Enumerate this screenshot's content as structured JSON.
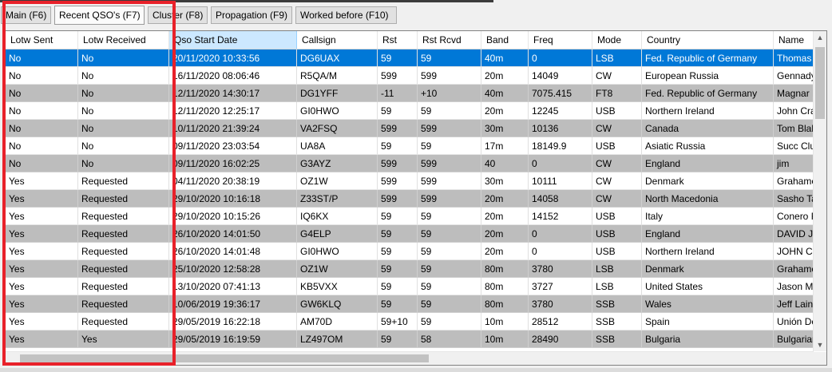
{
  "tabs": [
    {
      "label": "Main (F6)",
      "active": false
    },
    {
      "label": "Recent QSO's (F7)",
      "active": true
    },
    {
      "label": "Cluster (F8)",
      "active": false
    },
    {
      "label": "Propagation (F9)",
      "active": false
    },
    {
      "label": "Worked before (F10)",
      "active": false
    }
  ],
  "grid": {
    "columns": [
      "Lotw Sent",
      "Lotw Received",
      "Qso Start Date",
      "Callsign",
      "Rst",
      "Rst Rcvd",
      "Band",
      "Freq",
      "Mode",
      "Country",
      "Name"
    ],
    "sorted_column": "Qso Start Date",
    "rows": [
      [
        "No",
        "No",
        "20/11/2020 10:33:56",
        "DG6UAX",
        "59",
        "59",
        "40m",
        "0",
        "LSB",
        "Fed. Republic of Germany",
        "Thomas"
      ],
      [
        "No",
        "No",
        "16/11/2020 08:06:46",
        "R5QA/M",
        "599",
        "599",
        "20m",
        "14049",
        "CW",
        "European Russia",
        "Gennady"
      ],
      [
        "No",
        "No",
        "12/11/2020 14:30:17",
        "DG1YFF",
        "-11",
        "+10",
        "40m",
        "7075.415",
        "FT8",
        "Fed. Republic of Germany",
        "Magnar F"
      ],
      [
        "No",
        "No",
        "12/11/2020 12:25:17",
        "GI0HWO",
        "59",
        "59",
        "20m",
        "12245",
        "USB",
        "Northern Ireland",
        "John Cra"
      ],
      [
        "No",
        "No",
        "10/11/2020 21:39:24",
        "VA2FSQ",
        "599",
        "599",
        "30m",
        "10136",
        "CW",
        "Canada",
        "Tom Blak"
      ],
      [
        "No",
        "No",
        "09/11/2020 23:03:54",
        "UA8A",
        "59",
        "59",
        "17m",
        "18149.9",
        "USB",
        "Asiatic Russia",
        "Succ Clu"
      ],
      [
        "No",
        "No",
        "09/11/2020 16:02:25",
        "G3AYZ",
        "599",
        "599",
        "40",
        "0",
        "CW",
        "England",
        "jim"
      ],
      [
        "Yes",
        "Requested",
        "04/11/2020 20:38:19",
        "OZ1W",
        "599",
        "599",
        "30m",
        "10111",
        "CW",
        "Denmark",
        "Grahame"
      ],
      [
        "Yes",
        "Requested",
        "29/10/2020 10:16:18",
        "Z33ST/P",
        "599",
        "599",
        "20m",
        "14058",
        "CW",
        "North Macedonia",
        "Sasho Ta"
      ],
      [
        "Yes",
        "Requested",
        "29/10/2020 10:15:26",
        "IQ6KX",
        "59",
        "59",
        "20m",
        "14152",
        "USB",
        "Italy",
        "Conero F"
      ],
      [
        "Yes",
        "Requested",
        "26/10/2020 14:01:50",
        "G4ELP",
        "59",
        "59",
        "20m",
        "0",
        "USB",
        "England",
        "DAVID J"
      ],
      [
        "Yes",
        "Requested",
        "26/10/2020 14:01:48",
        "GI0HWO",
        "59",
        "59",
        "20m",
        "0",
        "USB",
        "Northern Ireland",
        "JOHN CR"
      ],
      [
        "Yes",
        "Requested",
        "25/10/2020 12:58:28",
        "OZ1W",
        "59",
        "59",
        "80m",
        "3780",
        "LSB",
        "Denmark",
        "Grahame"
      ],
      [
        "Yes",
        "Requested",
        "13/10/2020 07:41:13",
        "KB5VXX",
        "59",
        "59",
        "80m",
        "3727",
        "LSB",
        "United States",
        "Jason M"
      ],
      [
        "Yes",
        "Requested",
        "10/06/2019 19:36:17",
        "GW6KLQ",
        "59",
        "59",
        "80m",
        "3780",
        "SSB",
        "Wales",
        "Jeff Lain"
      ],
      [
        "Yes",
        "Requested",
        "29/05/2019 16:22:18",
        "AM70D",
        "59+10",
        "59",
        "10m",
        "28512",
        "SSB",
        "Spain",
        "Unión De"
      ],
      [
        "Yes",
        "Yes",
        "29/05/2019 16:19:59",
        "LZ497OM",
        "59",
        "58",
        "10m",
        "28490",
        "SSB",
        "Bulgaria",
        "Bulgarian"
      ]
    ]
  },
  "icons": {
    "scroll_up": "chevron-up-icon",
    "scroll_down": "chevron-down-icon"
  },
  "colors": {
    "selection": "#0078d7",
    "alt_row": "#bdbdbd",
    "highlight_box": "#e8212a",
    "sorted_header": "#cce8ff"
  }
}
